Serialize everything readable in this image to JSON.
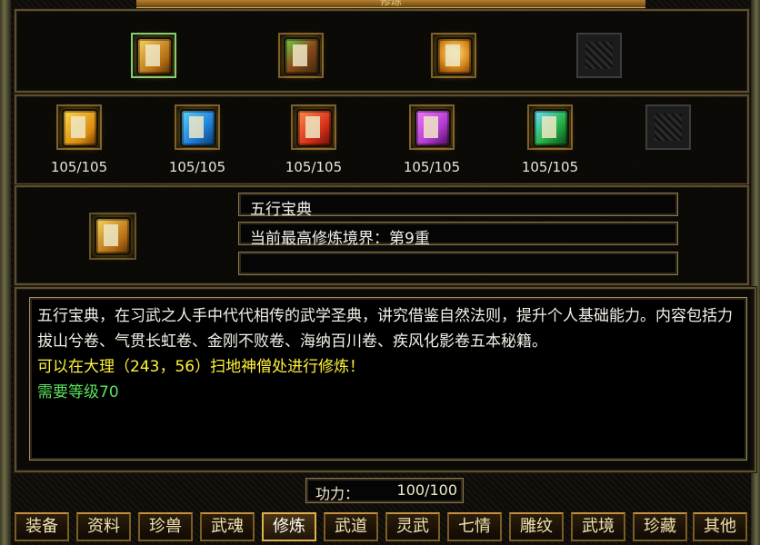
{
  "window": {
    "title": "修炼"
  },
  "top_slots": [
    {
      "icon": "golden-book-icon",
      "selected": true,
      "empty": false
    },
    {
      "icon": "scroll-bundle-icon",
      "selected": false,
      "empty": false
    },
    {
      "icon": "treasure-chest-icon",
      "selected": false,
      "empty": false
    },
    {
      "icon": "empty-slot-icon",
      "selected": false,
      "empty": true
    }
  ],
  "books": [
    {
      "icon": "yellow-book-icon",
      "color": "#e0a21a",
      "value": "105/105"
    },
    {
      "icon": "blue-book-icon",
      "color": "#1f8fd6",
      "value": "105/105"
    },
    {
      "icon": "red-book-icon",
      "color": "#d8321a",
      "value": "105/105"
    },
    {
      "icon": "purple-book-icon",
      "color": "#b23ad0",
      "value": "105/105"
    },
    {
      "icon": "green-book-icon",
      "color": "#27b54a",
      "value": "105/105"
    },
    {
      "icon": "empty-slot-icon",
      "color": "#1c1c1c",
      "value": ""
    }
  ],
  "info": {
    "name": "五行宝典",
    "realm": "当前最高修炼境界：第9重",
    "extra": ""
  },
  "description": {
    "white": "五行宝典，在习武之人手中代代相传的武学圣典，讲究借鉴自然法则，提升个人基础能力。内容包括力拔山兮卷、气贯长虹卷、金刚不败卷、海纳百川卷、疾风化影卷五本秘籍。",
    "yellow": "可以在大理（243，56）扫地神僧处进行修炼！",
    "green": "需要等级70"
  },
  "power": {
    "label": "功力：",
    "value": "100/100"
  },
  "tabs": [
    {
      "label": "装备",
      "active": false
    },
    {
      "label": "资料",
      "active": false
    },
    {
      "label": "珍兽",
      "active": false
    },
    {
      "label": "武魂",
      "active": false
    },
    {
      "label": "修炼",
      "active": true
    },
    {
      "label": "武道",
      "active": false
    },
    {
      "label": "灵武",
      "active": false
    },
    {
      "label": "七情",
      "active": false
    },
    {
      "label": "雕纹",
      "active": false
    },
    {
      "label": "武境",
      "active": false
    },
    {
      "label": "珍藏",
      "active": false
    },
    {
      "label": "其他",
      "active": false
    }
  ]
}
